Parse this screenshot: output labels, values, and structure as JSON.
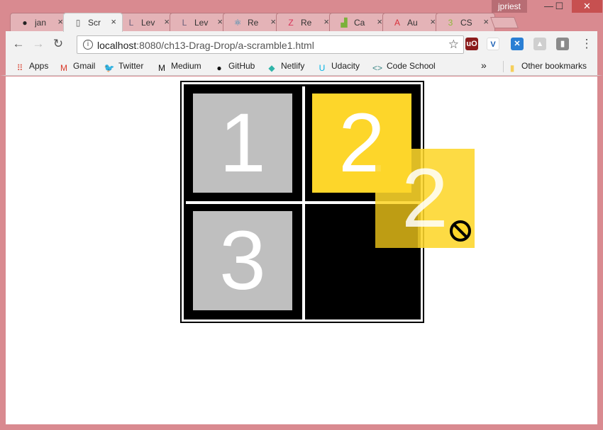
{
  "window": {
    "user": "jpriest",
    "minimize": "—",
    "maximize": "☐",
    "close": "✕"
  },
  "tabs": [
    {
      "label": "jan",
      "icon": "github-icon",
      "glyph": "●",
      "color": "#222222"
    },
    {
      "label": "Scr",
      "icon": "page-icon",
      "glyph": "▯",
      "color": "#555555",
      "active": true
    },
    {
      "label": "Lev",
      "icon": "l-icon",
      "glyph": "L",
      "color": "#6a5f7a"
    },
    {
      "label": "Lev",
      "icon": "l-icon",
      "glyph": "L",
      "color": "#6a5f7a"
    },
    {
      "label": "Re",
      "icon": "react-icon",
      "glyph": "⚛",
      "color": "#2b8ab3"
    },
    {
      "label": "Re",
      "icon": "az-icon",
      "glyph": "Z",
      "color": "#d9345a"
    },
    {
      "label": "Ca",
      "icon": "chart-icon",
      "glyph": "▟",
      "color": "#7bb13a"
    },
    {
      "label": "Au",
      "icon": "angular-icon",
      "glyph": "A",
      "color": "#d8303a"
    },
    {
      "label": "CS",
      "icon": "css-icon",
      "glyph": "3",
      "color": "#8fb83a"
    }
  ],
  "toolbar": {
    "back": "←",
    "forward": "→",
    "reload": "↻",
    "info": "i",
    "url_host": "localhost",
    "url_path": ":8080/ch13-Drag-Drop/a-scramble1.html",
    "star": "☆",
    "menu": "⋮"
  },
  "bookmarks": [
    {
      "label": "Apps",
      "icon": "apps-icon",
      "glyph": "⠿",
      "color": "#d94a3a"
    },
    {
      "label": "Gmail",
      "icon": "gmail-icon",
      "glyph": "M",
      "color": "#d93a2a"
    },
    {
      "label": "Twitter",
      "icon": "twitter-icon",
      "glyph": "🐦",
      "color": "#1da1f2"
    },
    {
      "label": "Medium",
      "icon": "medium-icon",
      "glyph": "M",
      "color": "#111111"
    },
    {
      "label": "GitHub",
      "icon": "github-icon",
      "glyph": "●",
      "color": "#111111"
    },
    {
      "label": "Netlify",
      "icon": "netlify-icon",
      "glyph": "◆",
      "color": "#2fb4a8"
    },
    {
      "label": "Udacity",
      "icon": "udacity-icon",
      "glyph": "U",
      "color": "#02b3e4"
    },
    {
      "label": "Code School",
      "icon": "code-icon",
      "glyph": "<>",
      "color": "#3b8686"
    }
  ],
  "bookmarks_more": "»",
  "other_bookmarks": {
    "label": "Other bookmarks",
    "icon": "folder-icon",
    "glyph": "▮",
    "color": "#f5cf5a"
  },
  "puzzle": {
    "tiles": [
      {
        "label": "1",
        "color": "grey"
      },
      {
        "label": "2",
        "color": "yellow"
      },
      {
        "label": "3",
        "color": "grey"
      },
      {
        "label": "",
        "color": "empty"
      }
    ],
    "drag_ghost": "2"
  }
}
